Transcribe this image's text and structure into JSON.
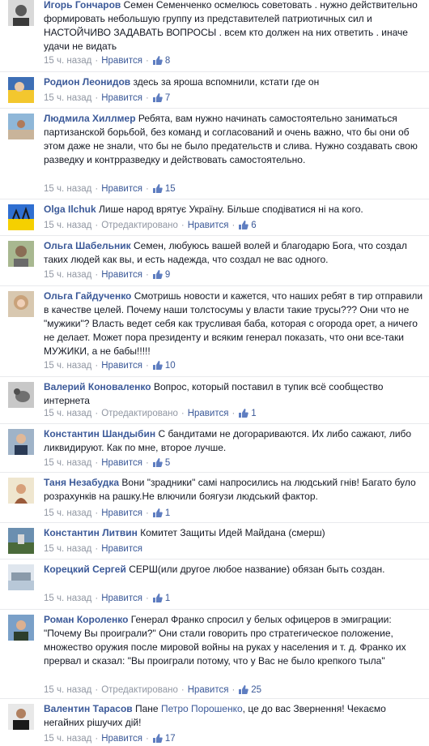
{
  "time_label": "15 ч. назад",
  "like_label": "Нравится",
  "edited_label": "Отредактировано",
  "comments": [
    {
      "author": "Игорь Гончаров",
      "text": "Семен Семенченко осмелюсь советовать . нужно действительно формировать небольшую группу из представителей патриотичных сил и НАСТОЙЧИВО ЗАДАВАТЬ ВОПРОСЫ . всем кто должен на них ответить . иначе удачи не видать",
      "likes": "8"
    },
    {
      "author": "Родион Леонидов",
      "text": "здесь за яроша вспомнили, кстати где он",
      "likes": "7"
    },
    {
      "author": "Людмила Хиллмер",
      "text": "Ребята, вам нужно начинать самостоятельно заниматься партизанской борьбой, без команд и согласований и очень важно, что бы они об этом даже не знали, что бы не было предательств и слива. Нужно создавать свою разведку и контрразведку и действовать самостоятельно.",
      "likes": "15"
    },
    {
      "author": "Olga Ilchuk",
      "text": "Лише народ врятує Україну. Більше сподіватися ні на кого.",
      "likes": "6"
    },
    {
      "author": "Ольга Шабельник",
      "text": "Семен, любуюсь вашей волей и благодарю Бога, что создал таких людей как вы, и есть надежда, что создал не вас одного.",
      "likes": "9"
    },
    {
      "author": "Ольга Гайдученко",
      "text": "Смотришь новости и кажется, что наших ребят в тир отправили в качестве целей. Почему наши толстосумы у власти такие трусы??? Они что не \"мужики\"? Власть ведет себя как трусливая баба, которая с огорода орет, а ничего не делает. Может пора президенту и всяким генерал показать, что они все-таки МУЖИКИ, а не бабы!!!!!",
      "likes": "10"
    },
    {
      "author": "Валерий Коноваленко",
      "text": "Вопрос, который поставил в тупик всё сообщество интернета",
      "likes": "1"
    },
    {
      "author": "Константин Шандыбин",
      "text": "С бандитами не догорариваются. Их либо сажают, либо ликвидируют. Как по мне, второе лучше.",
      "likes": "5"
    },
    {
      "author": "Таня Незабудка",
      "text": "Вони \"зрадники\" самі напросились на людський гнів! Багато було розрахунків на рашку.Не влючили боягузи людський фактор.",
      "likes": "1"
    },
    {
      "author": "Константин Литвин",
      "text": "Комитет Защиты Идей Майдана (смерш)",
      "likes": ""
    },
    {
      "author": "Корецкий Сергей",
      "text": "СЕРШ(или другое любое название) обязан быть создан.",
      "likes": "1"
    },
    {
      "author": "Роман Короленко",
      "text": "Генерал Франко спросил у белых офицеров в эмиграции: \"Почему Вы проиграли?\" Они стали говорить про стратегическое положение, множество оружия после мировой войны на руках у населения и т. д. Франко их прервал и сказал: \"Вы проиграли потому, что у Вас не было крепкого тыла\"",
      "likes": "25"
    },
    {
      "author": "Валентин Тарасов",
      "text_before": "Пане ",
      "text_link": "Петро Порошенко",
      "text_after": ", це до вас Звернення! Чекаємо негайних рішучих дій!",
      "likes": "17"
    }
  ]
}
